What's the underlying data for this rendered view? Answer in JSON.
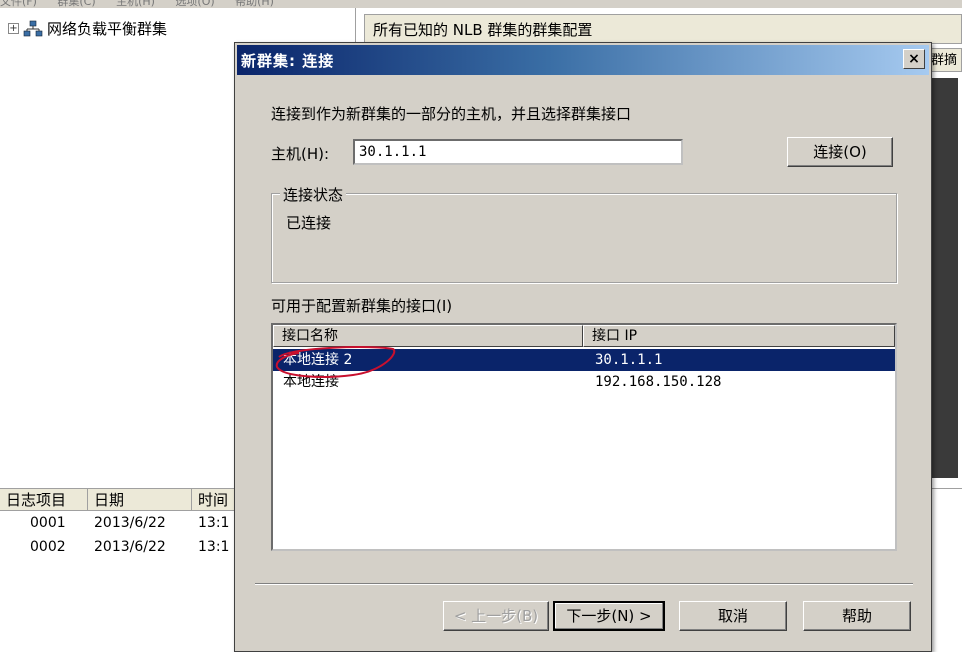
{
  "background": {
    "menu": [
      "文件(F)",
      "群集(C)",
      "主机(H)",
      "选项(O)",
      "帮助(H)"
    ],
    "tree_root": "网络负载平衡群集",
    "right_header": "所有已知的 NLB 群集的群集配置",
    "right_col_partial": "群摘",
    "log_columns": [
      "日志项目",
      "日期",
      "时间"
    ],
    "log_rows": [
      {
        "id": "0001",
        "date": "2013/6/22",
        "time": "13:1"
      },
      {
        "id": "0002",
        "date": "2013/6/22",
        "time": "13:1"
      }
    ]
  },
  "dialog": {
    "title": "新群集:  连接",
    "close_label": "×",
    "instruction": "连接到作为新群集的一部分的主机，并且选择群集接口",
    "host_label": "主机(H):",
    "host_value": "30.1.1.1",
    "connect_button": "连接(O)",
    "status_group_label": "连接状态",
    "status_text": "已连接",
    "interfaces_label": "可用于配置新群集的接口(I)",
    "interface_columns": [
      "接口名称",
      "接口 IP"
    ],
    "interfaces": [
      {
        "name": "本地连接 2",
        "ip": "30.1.1.1",
        "selected": true
      },
      {
        "name": "本地连接",
        "ip": "192.168.150.128",
        "selected": false
      }
    ],
    "buttons": {
      "back": "< 上一步(B)",
      "next": "下一步(N) >",
      "cancel": "取消",
      "help": "帮助"
    }
  },
  "colors": {
    "selection": "#0a246a",
    "annotation": "#c8102e",
    "dialog_bg": "#d4d0c8"
  }
}
